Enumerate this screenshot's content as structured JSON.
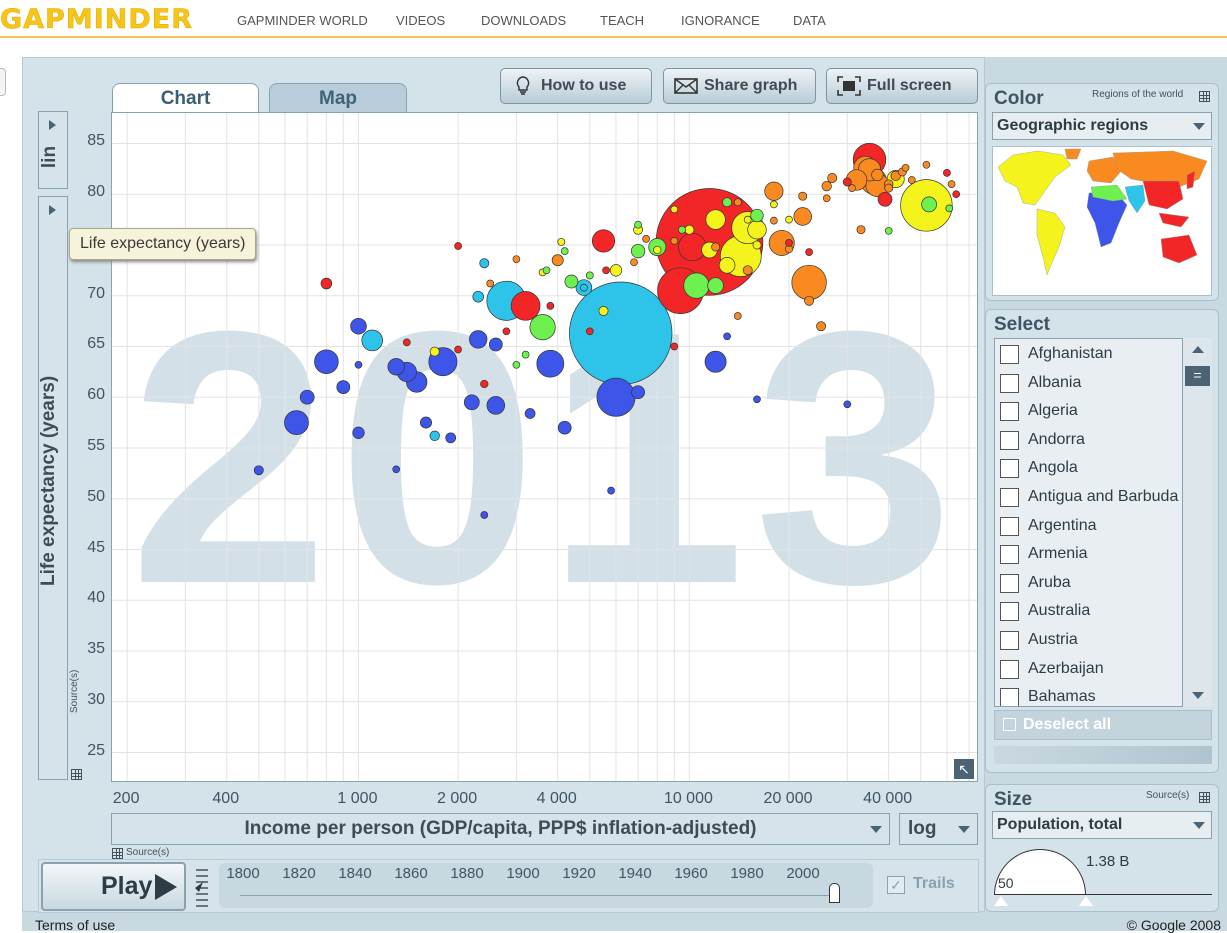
{
  "site": {
    "logo": "GAPMINDER",
    "nav": [
      "GAPMINDER WORLD",
      "VIDEOS",
      "DOWNLOADS",
      "TEACH",
      "IGNORANCE",
      "DATA"
    ]
  },
  "tabs": {
    "chart": "Chart",
    "map": "Map"
  },
  "toolbar": {
    "how_to_use": "How to use",
    "share_graph": "Share graph",
    "full_screen": "Full screen"
  },
  "y_axis": {
    "scale_label": "lin",
    "label": "Life expectancy (years)",
    "tooltip": "Life expectancy (years)",
    "source_label": "Source(s)"
  },
  "x_axis": {
    "label": "Income per person (GDP/capita, PPP$ inflation-adjusted)",
    "scale": "log",
    "source_label": "Source(s)"
  },
  "chart_data": {
    "type": "scatter",
    "year": "2013",
    "xscale": "log",
    "xlim": [
      180,
      75000
    ],
    "ylim": [
      22,
      88
    ],
    "x_ticks": [
      200,
      400,
      1000,
      2000,
      4000,
      10000,
      20000,
      40000
    ],
    "x_tick_labels": [
      "200",
      "400",
      "1 000",
      "2 000",
      "4 000",
      "10 000",
      "20 000",
      "40 000"
    ],
    "y_ticks": [
      25,
      30,
      35,
      40,
      45,
      50,
      55,
      60,
      65,
      70,
      75,
      80,
      85
    ],
    "colors": {
      "africa": "#3d55e8",
      "south_asia": "#2ec3e8",
      "east_asia": "#f22626",
      "europe": "#f98a1f",
      "americas": "#f4f41c",
      "middle_east": "#6ef04e"
    },
    "bubbles": [
      {
        "x": 6200,
        "y": 66.3,
        "pop": 1252,
        "region": "south_asia"
      },
      {
        "x": 11500,
        "y": 75.3,
        "pop": 1357,
        "region": "east_asia"
      },
      {
        "x": 52000,
        "y": 78.9,
        "pop": 316,
        "region": "americas"
      },
      {
        "x": 4800,
        "y": 70.8,
        "pop": 30,
        "region": "south_asia"
      },
      {
        "x": 2800,
        "y": 69.5,
        "pop": 182,
        "region": "south_asia"
      },
      {
        "x": 9400,
        "y": 70.5,
        "pop": 249,
        "region": "east_asia"
      },
      {
        "x": 14300,
        "y": 73.9,
        "pop": 200,
        "region": "americas"
      },
      {
        "x": 6000,
        "y": 60,
        "pop": 174,
        "region": "africa"
      },
      {
        "x": 23000,
        "y": 71.3,
        "pop": 143,
        "region": "europe"
      },
      {
        "x": 35000,
        "y": 83.4,
        "pop": 127,
        "region": "east_asia"
      },
      {
        "x": 15000,
        "y": 76.7,
        "pop": 122,
        "region": "americas"
      },
      {
        "x": 3200,
        "y": 69,
        "pop": 99,
        "region": "east_asia"
      },
      {
        "x": 1800,
        "y": 63.5,
        "pop": 94,
        "region": "africa"
      },
      {
        "x": 10200,
        "y": 74.8,
        "pop": 90,
        "region": "east_asia"
      },
      {
        "x": 10500,
        "y": 71,
        "pop": 77,
        "region": "middle_east"
      },
      {
        "x": 36000,
        "y": 81.3,
        "pop": 81,
        "region": "europe"
      },
      {
        "x": 19000,
        "y": 75.2,
        "pop": 75,
        "region": "europe"
      },
      {
        "x": 3600,
        "y": 66.9,
        "pop": 77,
        "region": "middle_east"
      },
      {
        "x": 3800,
        "y": 63.3,
        "pop": 87,
        "region": "africa"
      },
      {
        "x": 800,
        "y": 63.5,
        "pop": 67,
        "region": "africa"
      },
      {
        "x": 5500,
        "y": 75.4,
        "pop": 60,
        "region": "east_asia"
      },
      {
        "x": 12000,
        "y": 63.5,
        "pop": 53,
        "region": "africa"
      },
      {
        "x": 650,
        "y": 57.5,
        "pop": 68,
        "region": "africa"
      },
      {
        "x": 1100,
        "y": 65.6,
        "pop": 51,
        "region": "south_asia"
      },
      {
        "x": 34000,
        "y": 82.6,
        "pop": 64,
        "region": "europe"
      },
      {
        "x": 37000,
        "y": 80.9,
        "pop": 64,
        "region": "europe"
      },
      {
        "x": 35000,
        "y": 82.4,
        "pop": 60,
        "region": "europe"
      },
      {
        "x": 32000,
        "y": 81.4,
        "pop": 50,
        "region": "europe"
      },
      {
        "x": 1500,
        "y": 61.5,
        "pop": 50,
        "region": "africa"
      },
      {
        "x": 2300,
        "y": 65.7,
        "pop": 37,
        "region": "africa"
      },
      {
        "x": 1400,
        "y": 62.5,
        "pop": 45,
        "region": "africa"
      },
      {
        "x": 2600,
        "y": 59.2,
        "pop": 38,
        "region": "africa"
      },
      {
        "x": 7000,
        "y": 60.5,
        "pop": 20,
        "region": "africa"
      },
      {
        "x": 1000,
        "y": 67,
        "pop": 30,
        "region": "africa"
      },
      {
        "x": 700,
        "y": 60,
        "pop": 23,
        "region": "africa"
      },
      {
        "x": 4200,
        "y": 57,
        "pop": 20,
        "region": "africa"
      },
      {
        "x": 12000,
        "y": 77.5,
        "pop": 46,
        "region": "americas"
      },
      {
        "x": 16000,
        "y": 76.5,
        "pop": 41,
        "region": "americas"
      },
      {
        "x": 11500,
        "y": 74.5,
        "pop": 30,
        "region": "americas"
      },
      {
        "x": 8000,
        "y": 74.8,
        "pop": 35,
        "region": "middle_east"
      },
      {
        "x": 18000,
        "y": 80.3,
        "pop": 40,
        "region": "europe"
      },
      {
        "x": 22000,
        "y": 77.8,
        "pop": 38,
        "region": "europe"
      },
      {
        "x": 4400,
        "y": 71.4,
        "pop": 20,
        "region": "middle_east"
      },
      {
        "x": 2300,
        "y": 69.9,
        "pop": 14,
        "region": "south_asia"
      },
      {
        "x": 1300,
        "y": 63,
        "pop": 33,
        "region": "africa"
      },
      {
        "x": 2200,
        "y": 59.5,
        "pop": 27,
        "region": "africa"
      },
      {
        "x": 900,
        "y": 61,
        "pop": 20,
        "region": "africa"
      },
      {
        "x": 2600,
        "y": 65.2,
        "pop": 20,
        "region": "africa"
      },
      {
        "x": 1000,
        "y": 56.5,
        "pop": 16,
        "region": "africa"
      },
      {
        "x": 1600,
        "y": 57.5,
        "pop": 15,
        "region": "africa"
      },
      {
        "x": 1900,
        "y": 56,
        "pop": 12,
        "region": "africa"
      },
      {
        "x": 500,
        "y": 52.8,
        "pop": 10,
        "region": "africa"
      },
      {
        "x": 2400,
        "y": 48.4,
        "pop": 4,
        "region": "africa"
      },
      {
        "x": 3300,
        "y": 58.4,
        "pop": 12,
        "region": "africa"
      },
      {
        "x": 1300,
        "y": 52.9,
        "pop": 5,
        "region": "africa"
      },
      {
        "x": 5800,
        "y": 50.8,
        "pop": 2,
        "region": "africa"
      },
      {
        "x": 16000,
        "y": 59.8,
        "pop": 2,
        "region": "africa"
      },
      {
        "x": 30000,
        "y": 59.3,
        "pop": 1.5,
        "region": "africa"
      },
      {
        "x": 13000,
        "y": 66,
        "pop": 2,
        "region": "africa"
      },
      {
        "x": 1000,
        "y": 63.2,
        "pop": 5,
        "region": "africa"
      },
      {
        "x": 4800,
        "y": 70.8,
        "pop": 1.5,
        "region": "south_asia"
      },
      {
        "x": 2400,
        "y": 73.2,
        "pop": 10,
        "region": "south_asia"
      },
      {
        "x": 1700,
        "y": 56.2,
        "pop": 11,
        "region": "south_asia"
      },
      {
        "x": 800,
        "y": 71.2,
        "pop": 14,
        "region": "east_asia"
      },
      {
        "x": 2400,
        "y": 61.3,
        "pop": 7,
        "region": "east_asia"
      },
      {
        "x": 2000,
        "y": 64.7,
        "pop": 3,
        "region": "east_asia"
      },
      {
        "x": 5000,
        "y": 66.5,
        "pop": 2,
        "region": "east_asia"
      },
      {
        "x": 3800,
        "y": 69,
        "pop": 3,
        "region": "east_asia"
      },
      {
        "x": 9000,
        "y": 65,
        "pop": 2,
        "region": "east_asia"
      },
      {
        "x": 2800,
        "y": 66.5,
        "pop": 2,
        "region": "east_asia"
      },
      {
        "x": 5600,
        "y": 72.5,
        "pop": 3,
        "region": "east_asia"
      },
      {
        "x": 1400,
        "y": 65.4,
        "pop": 2,
        "region": "east_asia"
      },
      {
        "x": 2000,
        "y": 74.9,
        "pop": 2,
        "region": "east_asia"
      },
      {
        "x": 20000,
        "y": 75.2,
        "pop": 5,
        "region": "east_asia"
      },
      {
        "x": 23000,
        "y": 74.3,
        "pop": 5,
        "region": "east_asia"
      },
      {
        "x": 60000,
        "y": 82.1,
        "pop": 3,
        "region": "east_asia"
      },
      {
        "x": 64000,
        "y": 80,
        "pop": 1,
        "region": "east_asia"
      },
      {
        "x": 39000,
        "y": 79.5,
        "pop": 23,
        "region": "east_asia"
      },
      {
        "x": 30000,
        "y": 81.2,
        "pop": 8,
        "region": "east_asia"
      },
      {
        "x": 4000,
        "y": 73.5,
        "pop": 15,
        "region": "europe"
      },
      {
        "x": 2500,
        "y": 71.2,
        "pop": 3,
        "region": "europe"
      },
      {
        "x": 25000,
        "y": 67,
        "pop": 10,
        "region": "europe"
      },
      {
        "x": 15000,
        "y": 72.5,
        "pop": 10,
        "region": "europe"
      },
      {
        "x": 9000,
        "y": 75.4,
        "pop": 5,
        "region": "europe"
      },
      {
        "x": 12000,
        "y": 74.8,
        "pop": 8,
        "region": "europe"
      },
      {
        "x": 14000,
        "y": 68,
        "pop": 3,
        "region": "europe"
      },
      {
        "x": 45000,
        "y": 82.6,
        "pop": 5,
        "region": "europe"
      },
      {
        "x": 52000,
        "y": 82.9,
        "pop": 5,
        "region": "europe"
      },
      {
        "x": 42000,
        "y": 81.8,
        "pop": 11,
        "region": "europe"
      },
      {
        "x": 40000,
        "y": 80.6,
        "pop": 8,
        "region": "europe"
      },
      {
        "x": 27000,
        "y": 81.6,
        "pop": 10,
        "region": "europe"
      },
      {
        "x": 26000,
        "y": 80.8,
        "pop": 11,
        "region": "europe"
      },
      {
        "x": 22000,
        "y": 79.8,
        "pop": 8,
        "region": "europe"
      },
      {
        "x": 18000,
        "y": 77.4,
        "pop": 5,
        "region": "europe"
      },
      {
        "x": 20000,
        "y": 74.6,
        "pop": 7,
        "region": "europe"
      },
      {
        "x": 14000,
        "y": 79.2,
        "pop": 6,
        "region": "europe"
      },
      {
        "x": 62000,
        "y": 81,
        "pop": 0.5,
        "region": "europe"
      },
      {
        "x": 7400,
        "y": 75.6,
        "pop": 4,
        "region": "europe"
      },
      {
        "x": 6800,
        "y": 73.3,
        "pop": 3,
        "region": "europe"
      },
      {
        "x": 3000,
        "y": 73.6,
        "pop": 3,
        "region": "europe"
      },
      {
        "x": 23000,
        "y": 69.5,
        "pop": 10,
        "region": "europe"
      },
      {
        "x": 33000,
        "y": 76.5,
        "pop": 8,
        "region": "europe"
      },
      {
        "x": 31000,
        "y": 80.6,
        "pop": 5,
        "region": "europe"
      },
      {
        "x": 26000,
        "y": 79.6,
        "pop": 3,
        "region": "europe"
      },
      {
        "x": 37000,
        "y": 81.9,
        "pop": 16,
        "region": "europe"
      },
      {
        "x": 40000,
        "y": 81,
        "pop": 9,
        "region": "europe"
      },
      {
        "x": 44000,
        "y": 82.2,
        "pop": 8,
        "region": "europe"
      },
      {
        "x": 47000,
        "y": 81.4,
        "pop": 5,
        "region": "europe"
      },
      {
        "x": 12000,
        "y": 71,
        "pop": 30,
        "region": "middle_east"
      },
      {
        "x": 16000,
        "y": 77.9,
        "pop": 19,
        "region": "middle_east"
      },
      {
        "x": 7000,
        "y": 74.4,
        "pop": 22,
        "region": "middle_east"
      },
      {
        "x": 5000,
        "y": 72,
        "pop": 6,
        "region": "middle_east"
      },
      {
        "x": 9500,
        "y": 76.5,
        "pop": 6,
        "region": "middle_east"
      },
      {
        "x": 13000,
        "y": 79.2,
        "pop": 10,
        "region": "middle_east"
      },
      {
        "x": 3000,
        "y": 63.2,
        "pop": 2,
        "region": "middle_east"
      },
      {
        "x": 3200,
        "y": 64.2,
        "pop": 2,
        "region": "middle_east"
      },
      {
        "x": 53000,
        "y": 79,
        "pop": 27,
        "region": "middle_east"
      },
      {
        "x": 40000,
        "y": 76.4,
        "pop": 2,
        "region": "middle_east"
      },
      {
        "x": 61000,
        "y": 78.6,
        "pop": 2,
        "region": "middle_east"
      },
      {
        "x": 4200,
        "y": 74.4,
        "pop": 3,
        "region": "middle_east"
      },
      {
        "x": 7000,
        "y": 77,
        "pop": 5,
        "region": "middle_east"
      },
      {
        "x": 3700,
        "y": 72.5,
        "pop": 2,
        "region": "middle_east"
      },
      {
        "x": 16000,
        "y": 75,
        "pop": 8,
        "region": "americas"
      },
      {
        "x": 15000,
        "y": 77.5,
        "pop": 3,
        "region": "americas"
      },
      {
        "x": 10000,
        "y": 76.5,
        "pop": 10,
        "region": "americas"
      },
      {
        "x": 7000,
        "y": 76.5,
        "pop": 10,
        "region": "americas"
      },
      {
        "x": 6000,
        "y": 72.5,
        "pop": 16,
        "region": "americas"
      },
      {
        "x": 3600,
        "y": 72.3,
        "pop": 5,
        "region": "americas"
      },
      {
        "x": 4100,
        "y": 75.3,
        "pop": 6,
        "region": "americas"
      },
      {
        "x": 1700,
        "y": 64.5,
        "pop": 10,
        "region": "americas"
      },
      {
        "x": 9000,
        "y": 78.5,
        "pop": 4,
        "region": "americas"
      },
      {
        "x": 13000,
        "y": 73,
        "pop": 30,
        "region": "americas"
      },
      {
        "x": 5500,
        "y": 68.5,
        "pop": 10,
        "region": "americas"
      },
      {
        "x": 8000,
        "y": 74.5,
        "pop": 7,
        "region": "americas"
      },
      {
        "x": 20000,
        "y": 77.5,
        "pop": 3,
        "region": "americas"
      },
      {
        "x": 42000,
        "y": 81.5,
        "pop": 35,
        "region": "americas"
      },
      {
        "x": 18000,
        "y": 79,
        "pop": 4,
        "region": "americas"
      }
    ]
  },
  "timeline": {
    "play_label": "Play",
    "years": [
      "1800",
      "1820",
      "1840",
      "1860",
      "1880",
      "1900",
      "1920",
      "1940",
      "1960",
      "1980",
      "2000"
    ],
    "trails_label": "Trails",
    "trails_checked": "✓"
  },
  "color_panel": {
    "title": "Color",
    "subtitle": "Regions of the world",
    "dropdown_value": "Geographic regions"
  },
  "select_panel": {
    "title": "Select",
    "countries": [
      "Afghanistan",
      "Albania",
      "Algeria",
      "Andorra",
      "Angola",
      "Antigua and Barbuda",
      "Argentina",
      "Armenia",
      "Aruba",
      "Australia",
      "Austria",
      "Azerbaijan",
      "Bahamas"
    ],
    "deselect_label": "Deselect all"
  },
  "size_panel": {
    "title": "Size",
    "source_label": "Source(s)",
    "dropdown_value": "Population, total",
    "max_label": "1.38 B",
    "min_label": "50"
  },
  "footer": {
    "terms": "Terms of use",
    "copyright": "© Google 2008"
  }
}
